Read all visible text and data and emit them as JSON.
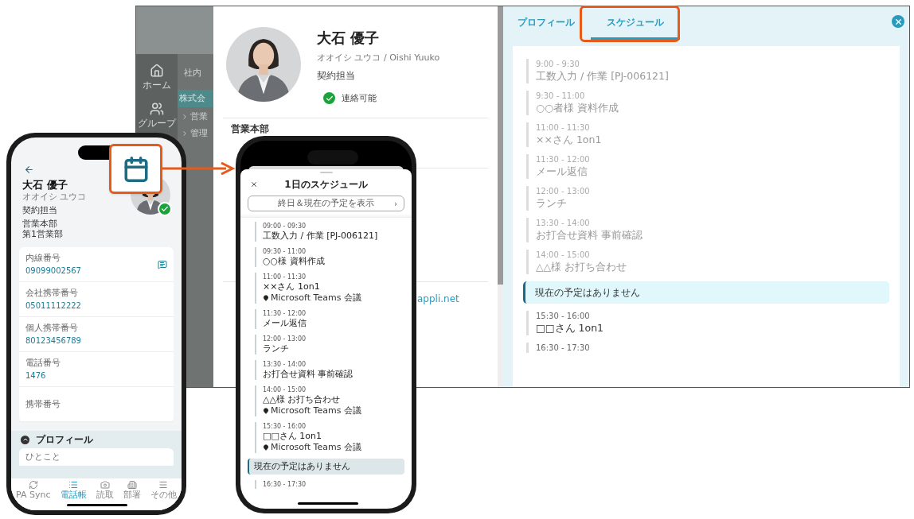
{
  "desktop": {
    "sidebar": [
      {
        "label": "ホーム",
        "selected": false
      },
      {
        "label": "グループ",
        "selected": false
      }
    ],
    "tree": {
      "header": "社内",
      "company": "株式会",
      "items": [
        "営業",
        "管理"
      ]
    },
    "profile": {
      "name": "大石 優子",
      "reading": "オオイシ ユウコ / Oishi Yuuko",
      "role": "契約担当",
      "status": "連絡可能",
      "department": "営業本部",
      "email": "appli.net"
    },
    "tabs": [
      {
        "label": "プロフィール",
        "selected": false
      },
      {
        "label": "スケジュール",
        "selected": true
      }
    ],
    "schedule": [
      {
        "kind": "event",
        "time": "9:00 - 9:30",
        "title": "工数入力 / 作業 [PJ-006121]",
        "past": true
      },
      {
        "kind": "event",
        "time": "9:30 - 11:00",
        "title": "○○者様 資料作成",
        "past": true
      },
      {
        "kind": "event",
        "time": "11:00 - 11:30",
        "title": "××さん 1on1",
        "past": true
      },
      {
        "kind": "event",
        "time": "11:30 - 12:00",
        "title": "メール返信",
        "past": true
      },
      {
        "kind": "event",
        "time": "12:00 - 13:00",
        "title": "ランチ",
        "past": true
      },
      {
        "kind": "event",
        "time": "13:30 - 14:00",
        "title": "お打合せ資料 事前確認",
        "past": true
      },
      {
        "kind": "event",
        "time": "14:00 - 15:00",
        "title": "△△様 お打ち合わせ",
        "past": true
      },
      {
        "kind": "now",
        "title": "現在の予定はありません"
      },
      {
        "kind": "event",
        "time": "15:30 - 16:00",
        "title": "□□さん 1on1",
        "past": false
      },
      {
        "kind": "event",
        "time": "16:30 - 17:30",
        "past": false
      }
    ]
  },
  "contact_phone": {
    "name": "大石 優子",
    "reading": "オオイシ ユウコ",
    "role": "契約担当",
    "departments": [
      "営業本部",
      "第1営業部"
    ],
    "available": true,
    "fields": [
      {
        "label": "内線番号",
        "value": "09099002567",
        "sms": true
      },
      {
        "label": "会社携帯番号",
        "value": "05011112222",
        "sms": false
      },
      {
        "label": "個人携帯番号",
        "value": "80123456789",
        "sms": false
      },
      {
        "label": "電話番号",
        "value": "1476",
        "sms": false
      },
      {
        "label": "携帯番号",
        "sms": false
      }
    ],
    "profile_section": {
      "title": "プロフィール",
      "expanded": true,
      "first_field": "ひとこと"
    },
    "nav": [
      {
        "label": "PA Sync",
        "selected": false
      },
      {
        "label": "電話帳",
        "selected": true
      },
      {
        "label": "読取",
        "selected": false
      },
      {
        "label": "部署",
        "selected": false
      },
      {
        "label": "その他",
        "selected": false
      }
    ]
  },
  "schedule_phone": {
    "title": "1日のスケジュール",
    "all_day_button": "終日＆現在の予定を表示",
    "chevron": "›",
    "items": [
      {
        "kind": "event",
        "time": "09:00 - 09:30",
        "title": "工数入力 / 作業 [PJ-006121]"
      },
      {
        "kind": "event",
        "time": "09:30 - 11:00",
        "title": "○○様 資料作成"
      },
      {
        "kind": "event",
        "time": "11:00 - 11:30",
        "title": "××さん 1on1",
        "location": "Microsoft Teams 会議"
      },
      {
        "kind": "event",
        "time": "11:30 - 12:00",
        "title": "メール返信"
      },
      {
        "kind": "event",
        "time": "12:00 - 13:00",
        "title": "ランチ"
      },
      {
        "kind": "event",
        "time": "13:30 - 14:00",
        "title": "お打合せ資料 事前確認"
      },
      {
        "kind": "event",
        "time": "14:00 - 15:00",
        "title": "△△様 お打ち合わせ",
        "location": "Microsoft Teams 会議"
      },
      {
        "kind": "event",
        "time": "15:30 - 16:00",
        "title": "□□さん 1on1",
        "location": "Microsoft Teams 会議"
      },
      {
        "kind": "now",
        "title": "現在の予定はありません"
      },
      {
        "kind": "event",
        "time": "16:30 - 17:30"
      }
    ]
  }
}
